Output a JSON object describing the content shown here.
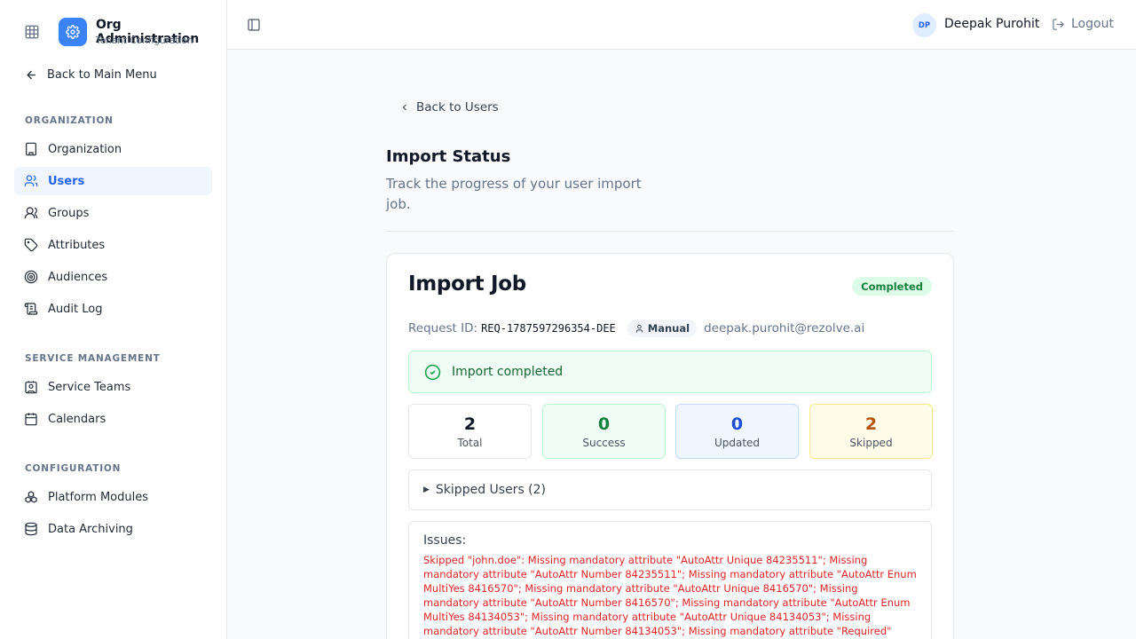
{
  "brand": {
    "title": "Org Administration",
    "subtitle": "Tenant Configuration"
  },
  "sidebar": {
    "back_label": "Back to Main Menu",
    "sections": [
      {
        "label": "ORGANIZATION"
      },
      {
        "label": "SERVICE MANAGEMENT"
      },
      {
        "label": "CONFIGURATION"
      }
    ],
    "items": [
      {
        "label": "Organization",
        "icon": "building-icon"
      },
      {
        "label": "Users",
        "icon": "users-icon",
        "active": true
      },
      {
        "label": "Groups",
        "icon": "groups-icon"
      },
      {
        "label": "Attributes",
        "icon": "tag-icon"
      },
      {
        "label": "Audiences",
        "icon": "target-icon"
      },
      {
        "label": "Audit Log",
        "icon": "scroll-icon"
      },
      {
        "label": "Service Teams",
        "icon": "contact-icon"
      },
      {
        "label": "Calendars",
        "icon": "calendar-icon"
      },
      {
        "label": "Platform Modules",
        "icon": "modules-icon"
      },
      {
        "label": "Data Archiving",
        "icon": "database-icon"
      }
    ]
  },
  "header": {
    "avatar_initials": "DP",
    "user_name": "Deepak Purohit",
    "logout_label": "Logout"
  },
  "main": {
    "back_label": "Back to Users",
    "title": "Import Status",
    "description": "Track the progress of your user import job."
  },
  "job": {
    "title": "Import Job",
    "status": "Completed",
    "request_label": "Request ID:",
    "request_id": "REQ-1787597296354-DEE",
    "mode": "Manual",
    "email": "deepak.purohit@rezolve.ai",
    "alert": "Import completed",
    "stats": [
      {
        "value": "2",
        "label": "Total"
      },
      {
        "value": "0",
        "label": "Success"
      },
      {
        "value": "0",
        "label": "Updated"
      },
      {
        "value": "2",
        "label": "Skipped"
      }
    ],
    "skipped_label": "Skipped Users (2)",
    "issues_label": "Issues:",
    "issues_text": "Skipped \"john.doe\": Missing mandatory attribute \"AutoAttr Unique 84235511\"; Missing mandatory attribute \"AutoAttr Number 84235511\"; Missing mandatory attribute \"AutoAttr Enum MultiYes 8416570\"; Missing mandatory attribute \"AutoAttr Unique 8416570\"; Missing mandatory attribute \"AutoAttr Number 8416570\"; Missing mandatory attribute \"AutoAttr Enum MultiYes 84134053\"; Missing mandatory attribute \"AutoAttr Unique 84134053\"; Missing mandatory attribute \"AutoAttr Number 84134053\"; Missing mandatory attribute \"Required\""
  },
  "colors": {
    "accent": "#3b82f6",
    "success": "#15803d",
    "updated": "#1d4ed8",
    "skipped": "#b45309",
    "error": "#dc2626"
  }
}
